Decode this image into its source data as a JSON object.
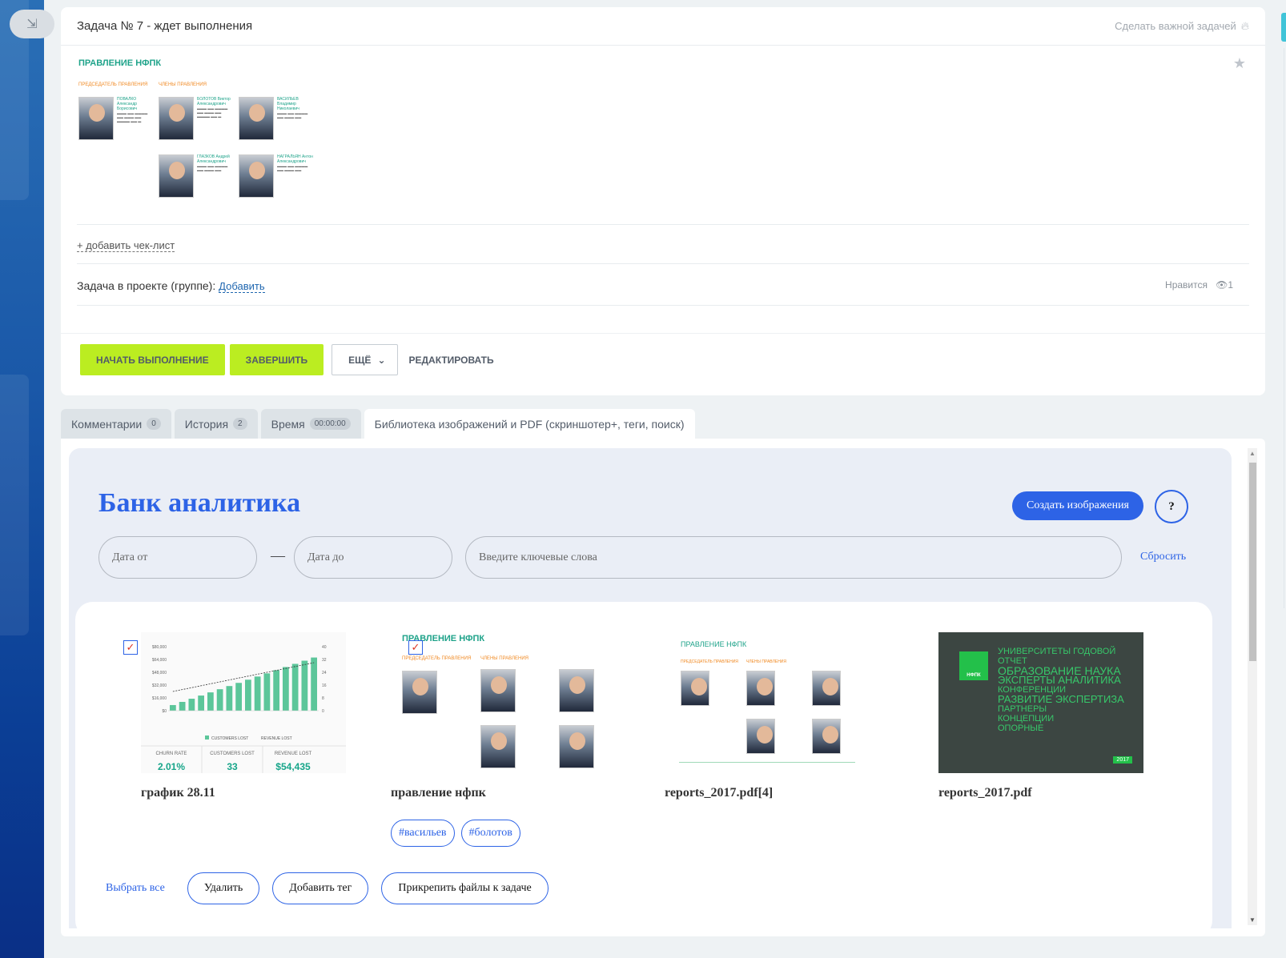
{
  "task": {
    "title": "Задача № 7 - ждет выполнения",
    "make_important": "Сделать важной задачей",
    "add_checklist": "+ добавить чек-лист",
    "project_label": "Задача в проекте (группе):",
    "project_add": "Добавить",
    "likes": "Нравится",
    "views": "1",
    "buttons": {
      "start": "НАЧАТЬ ВЫПОЛНЕНИЕ",
      "finish": "ЗАВЕРШИТЬ",
      "more": "ЕЩЁ",
      "edit": "РЕДАКТИРОВАТЬ"
    }
  },
  "org_chart": {
    "title": "ПРАВЛЕНИЕ НФПК",
    "chairman_label": "ПРЕДСЕДАТЕЛЬ ПРАВЛЕНИЯ",
    "members_label": "ЧЛЕНЫ ПРАВЛЕНИЯ",
    "people": [
      {
        "name": "ПОВАЛКО Александр Борисович"
      },
      {
        "name": "БОЛОТОВ Виктор Александрович"
      },
      {
        "name": "ВАСИЛЬЕВ Владимир Николаевич"
      },
      {
        "name": "ГЛАЗКОВ Андрей Александрович"
      },
      {
        "name": "НАГРАЛЬЯН Антон Александрович"
      }
    ]
  },
  "tabs": [
    {
      "label": "Комментарии",
      "counter": "0"
    },
    {
      "label": "История",
      "counter": "2"
    },
    {
      "label": "Время",
      "counter": "00:00:00"
    },
    {
      "label": "Библиотека изображений и PDF (скриншотер+, теги, поиск)",
      "counter": ""
    }
  ],
  "library": {
    "title": "Банк аналитика",
    "create_button": "Создать изображения",
    "help": "?",
    "date_from_placeholder": "Дата от",
    "date_separator": "—",
    "date_to_placeholder": "Дата до",
    "keywords_placeholder": "Введите ключевые слова",
    "reset": "Сбросить",
    "items": [
      {
        "name": "график 28.11",
        "checked": true,
        "tags": []
      },
      {
        "name": "правление нфпк",
        "checked": true,
        "tags": [
          "#васильев",
          "#болотов"
        ]
      },
      {
        "name": "reports_2017.pdf[4]",
        "checked": false,
        "tags": []
      },
      {
        "name": "reports_2017.pdf",
        "checked": false,
        "tags": []
      }
    ],
    "actions": {
      "select_all": "Выбрать все",
      "delete": "Удалить",
      "add_tag": "Добавить тег",
      "attach": "Прикрепить файлы к задаче"
    }
  },
  "thumb_chart": {
    "stats": [
      {
        "label": "CHURN RATE",
        "value": "2.01%"
      },
      {
        "label": "CUSTOMERS LOST",
        "value": "33"
      },
      {
        "label": "REVENUE LOST",
        "value": "$54,435"
      }
    ],
    "legend": [
      "CUSTOMERS LOST",
      "REVENUE LOST"
    ],
    "y_ticks": [
      "$80,000",
      "$64,000",
      "$48,000",
      "$32,000",
      "$16,000",
      "$0"
    ],
    "y2_ticks": [
      "40",
      "32",
      "24",
      "16",
      "8",
      "0"
    ]
  },
  "cover": {
    "logo": "НФПК",
    "words": [
      "УНИВЕРСИТЕТЫ ГОДОВОЙ ОТЧЕТ",
      "ОБРАЗОВАНИЕ НАУКА",
      "ЭКСПЕРТЫ АНАЛИТИКА",
      "КОНФЕРЕНЦИИ",
      "РАЗВИТИЕ ЭКСПЕРТИЗА",
      "ПАРТНЕРЫ",
      "КОНЦЕПЦИИ",
      "ОПОРНЫЕ"
    ],
    "year": "2017"
  },
  "colors": {
    "accent_green": "#bbed21",
    "bank_blue": "#2d63e6",
    "org_teal": "#1fa38a"
  }
}
